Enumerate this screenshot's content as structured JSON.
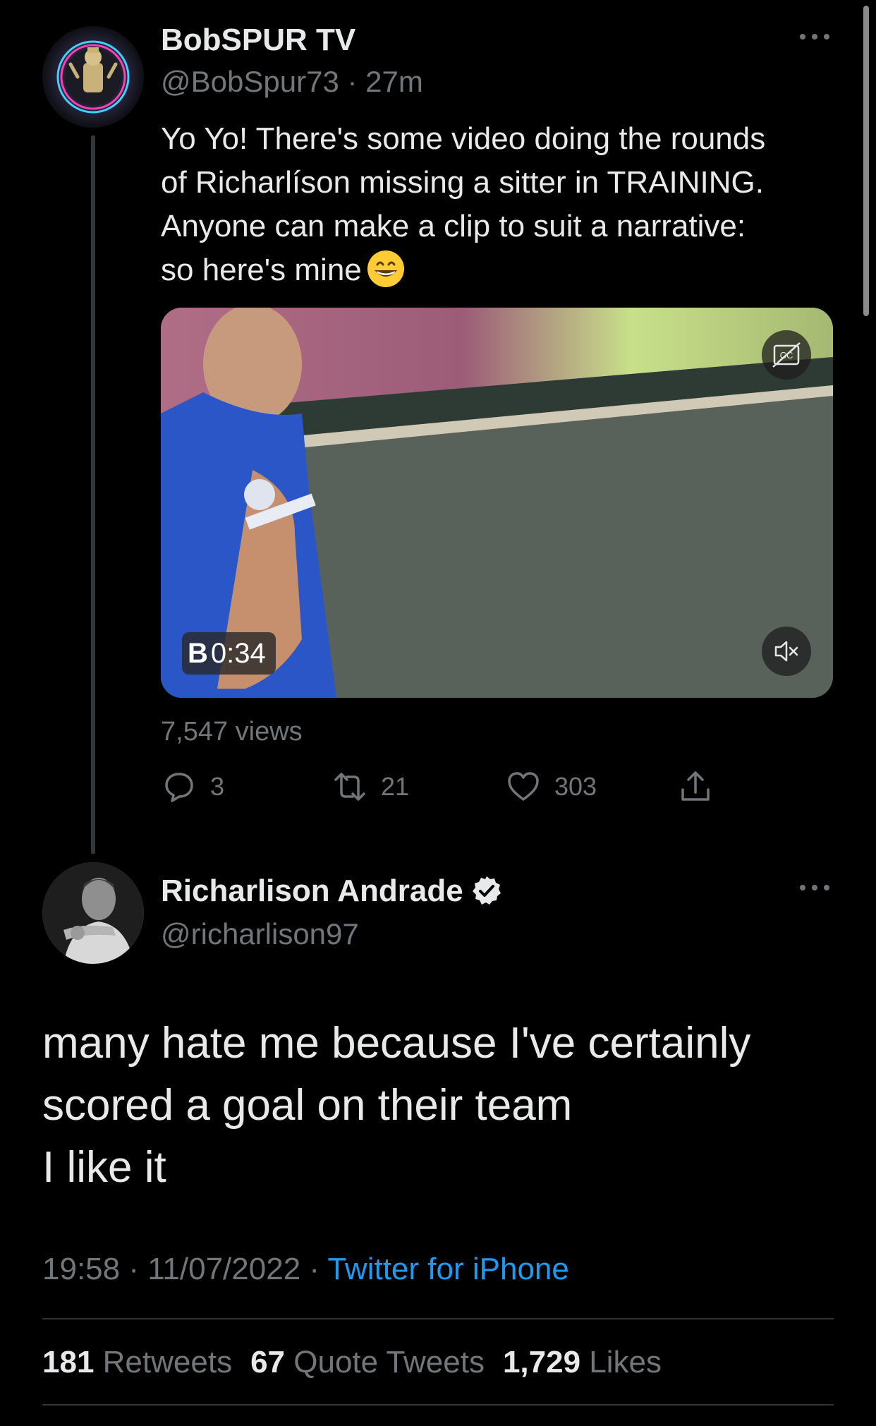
{
  "parent_tweet": {
    "display_name": "BobSPUR TV",
    "handle": "@BobSpur73",
    "separator": "·",
    "time_ago": "27m",
    "text": "Yo Yo! There's some video doing the rounds\nof Richarlíson missing a sitter in TRAINING.\nAnyone can make a clip to suit a narrative:\nso here's mine",
    "emoji": "grinning-face-with-smiling-eyes",
    "video": {
      "duration": "0:34",
      "badge_prefix": "B"
    },
    "views": "7,547 views",
    "actions": {
      "replies": "3",
      "retweets": "21",
      "likes": "303"
    }
  },
  "main_tweet": {
    "display_name": "Richarlison Andrade",
    "handle": "@richarlison97",
    "text": "many hate me because I've certainly\nscored a goal on their team\nI like it",
    "time": "19:58",
    "separator": " · ",
    "date": "11/07/2022",
    "source": "Twitter for iPhone",
    "stats": {
      "retweets_count": "181",
      "retweets_label": "Retweets",
      "quote_count": "67",
      "quote_label": "Quote Tweets",
      "likes_count": "1,729",
      "likes_label": "Likes"
    }
  },
  "colors": {
    "background": "#000000",
    "primary_text": "#e7e9ea",
    "secondary_text": "#71767b",
    "link": "#1d9bf0",
    "divider": "#2f3336"
  }
}
